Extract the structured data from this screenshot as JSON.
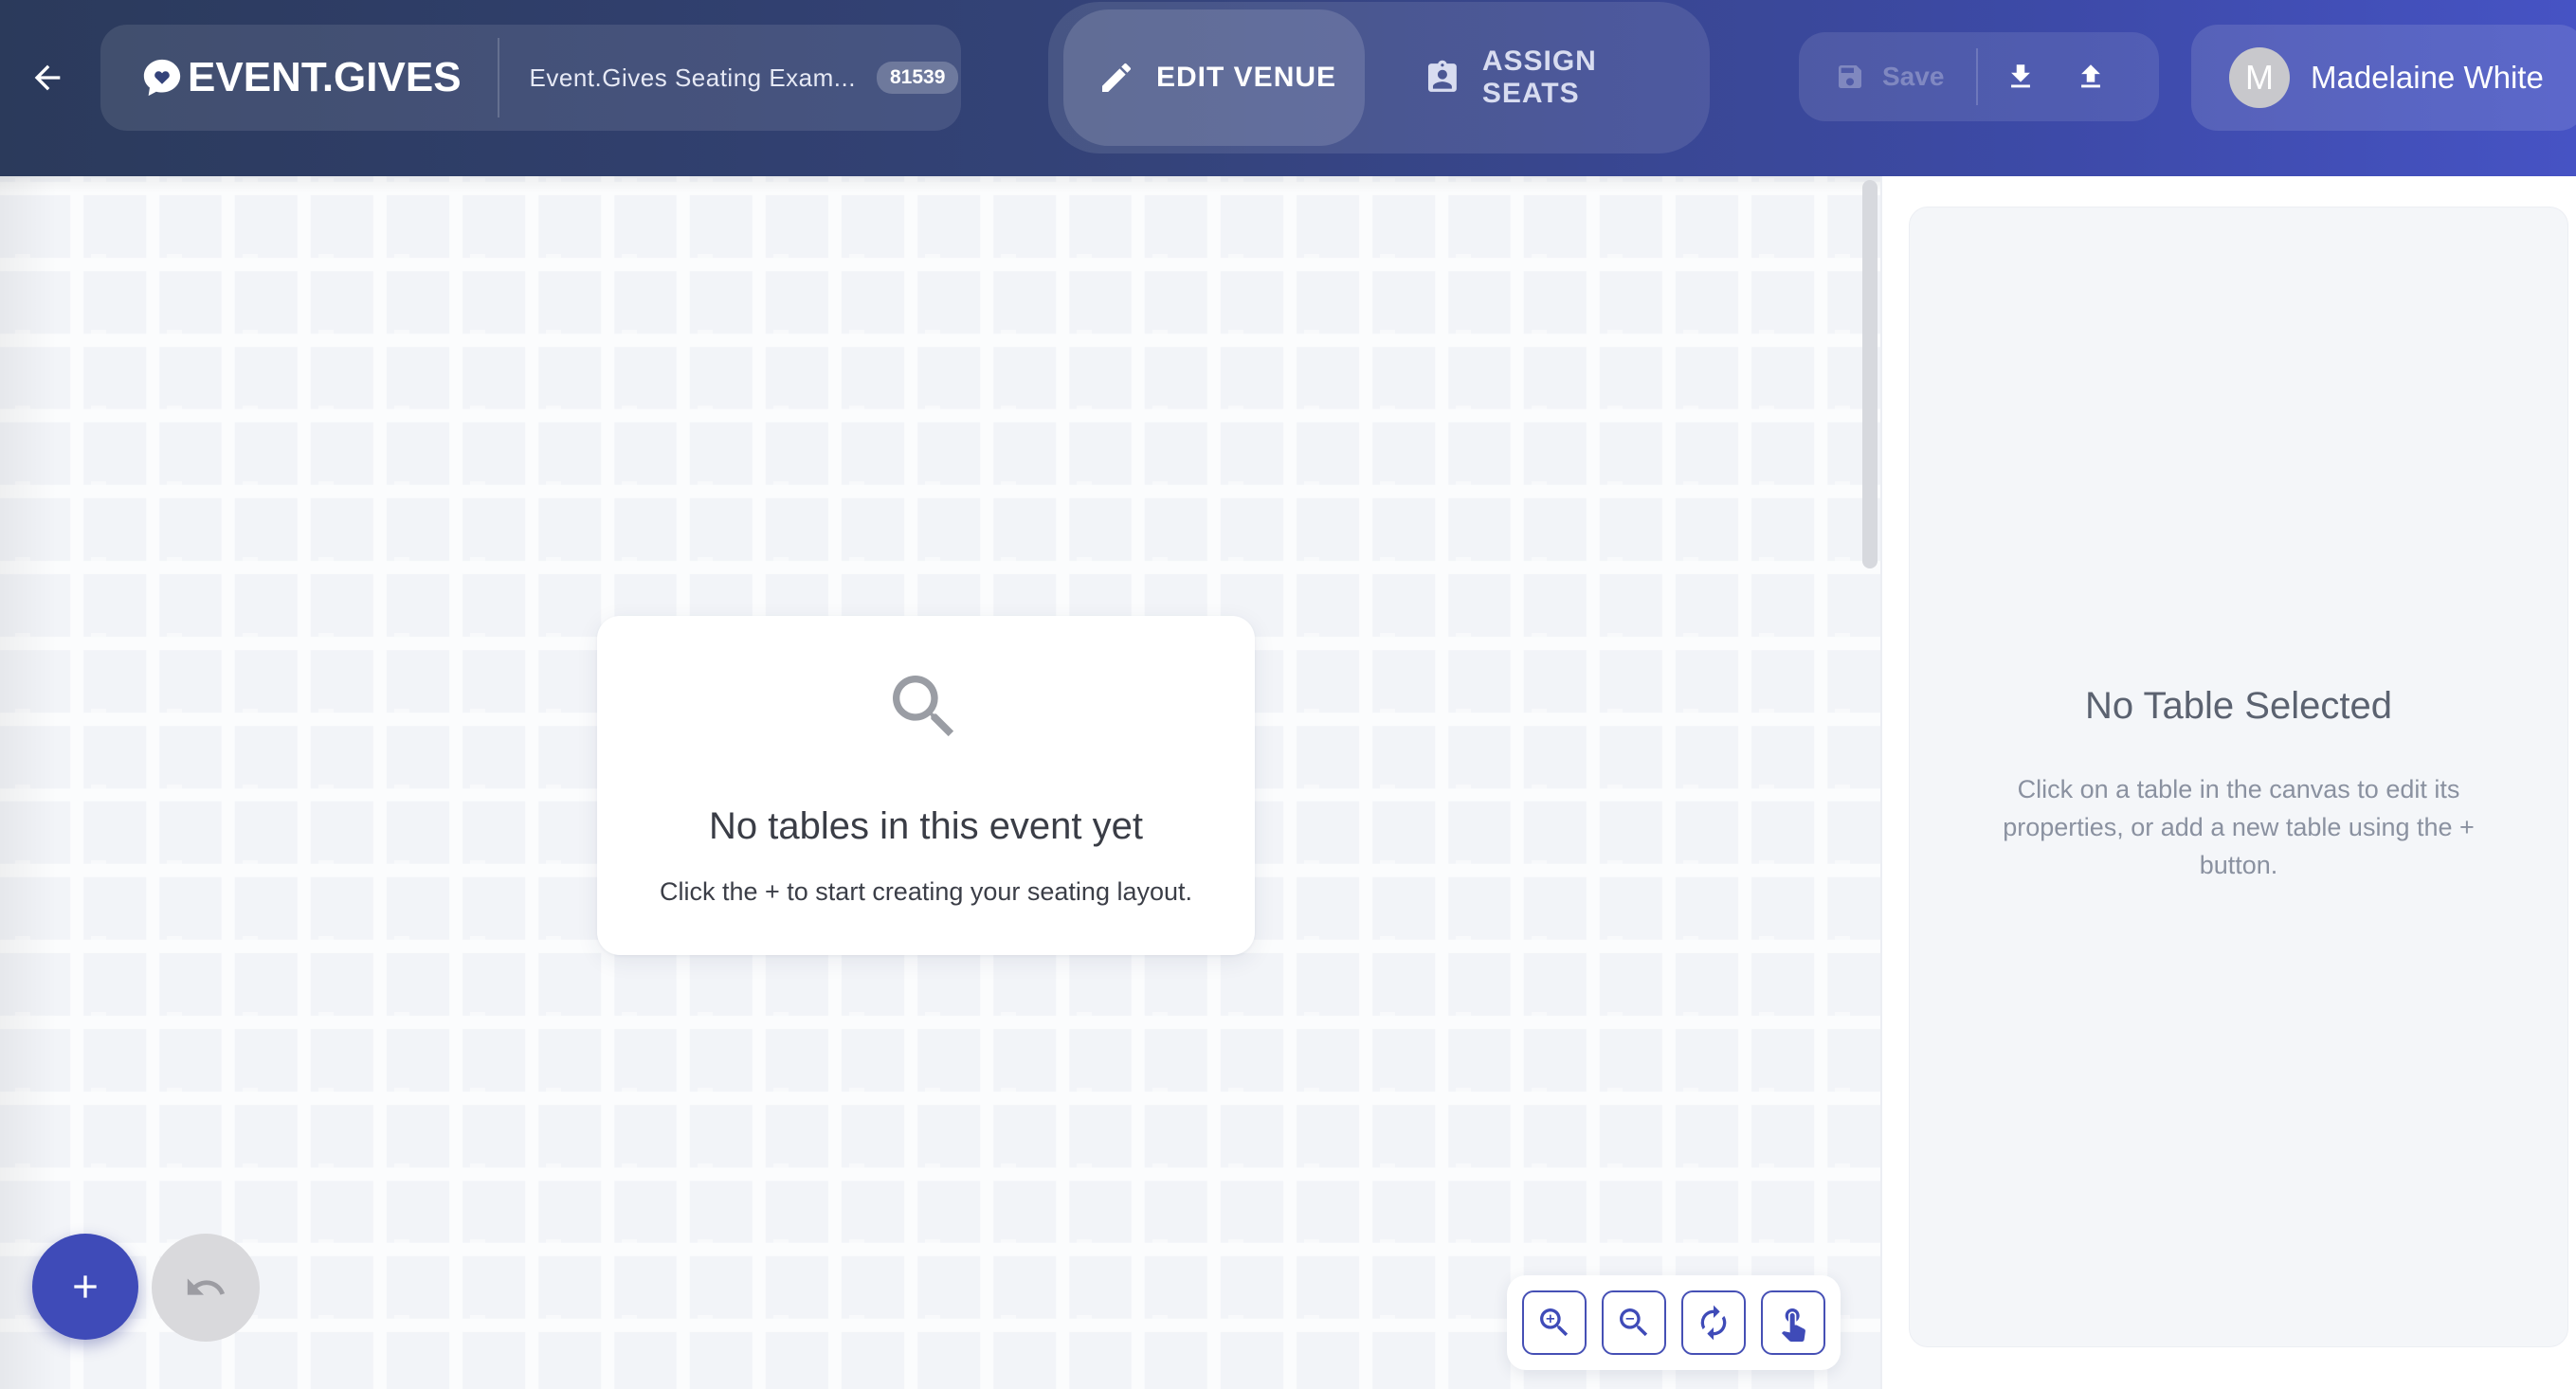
{
  "header": {
    "back_icon": "arrow-left-icon",
    "logo_text": "EVENT.GIVES",
    "event_name": "Event.Gives Seating Exam...",
    "event_id": "81539",
    "modes": [
      {
        "label": "EDIT VENUE",
        "icon": "pencil-icon",
        "active": true
      },
      {
        "label": "ASSIGN SEATS",
        "icon": "clipboard-user-icon",
        "active": false
      }
    ],
    "save_label": "Save",
    "user_initial": "M",
    "user_name": "Madelaine White"
  },
  "canvas": {
    "empty_title": "No tables in this event yet",
    "empty_subtitle": "Click the + to start creating your seating layout.",
    "add_icon": "plus-icon",
    "undo_icon": "undo-icon",
    "zoom_tools": [
      "zoom-in-icon",
      "zoom-out-icon",
      "reset-rotate-icon",
      "pan-hand-icon"
    ]
  },
  "side_panel": {
    "title": "No Table Selected",
    "description": "Click on a table in the canvas to edit its properties, or add a new table using the + button."
  },
  "colors": {
    "header_start": "#2b3a5b",
    "header_end": "#4653c4",
    "accent": "#3f4bb8"
  }
}
